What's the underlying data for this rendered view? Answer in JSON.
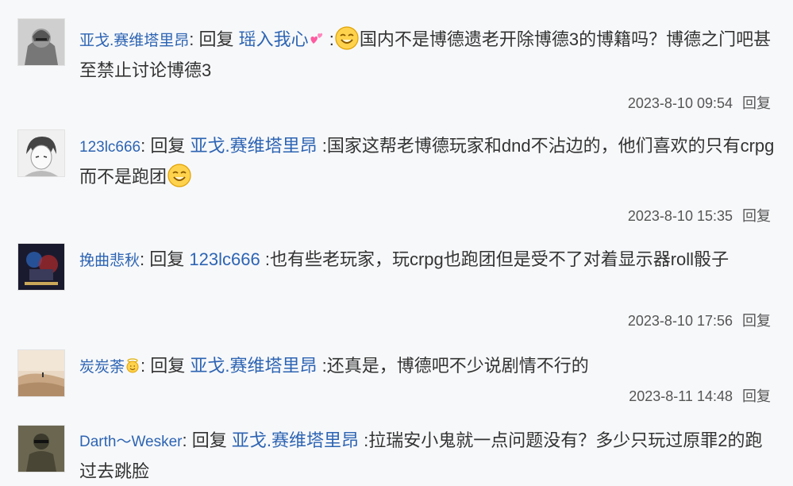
{
  "replies": [
    {
      "username": "亚戈.赛维塔里昂",
      "reply_word": "回复",
      "target": "瑶入我心",
      "target_icon": "pink-hearts-icon",
      "content_prefix_icon": "smile-emoji-icon",
      "content": "国内不是博德遗老开除博德3的博籍吗？博德之门吧甚至禁止讨论博德3",
      "time": "2023-8-10 09:54",
      "reply_action": "回复"
    },
    {
      "username": "123lc666",
      "reply_word": "回复",
      "target": "亚戈.赛维塔里昂",
      "content": "国家这帮老博德玩家和dnd不沾边的，他们喜欢的只有crpg而不是跑团",
      "content_suffix_icon": "smile-emoji-icon",
      "time": "2023-8-10 15:35",
      "reply_action": "回复"
    },
    {
      "username": "挽曲悲秋",
      "reply_word": "回复",
      "target": "123lc666",
      "content": "也有些老玩家，玩crpg也跑团但是受不了对着显示器roll骰子",
      "time": "2023-8-10 17:56",
      "reply_action": "回复"
    },
    {
      "username": "炭炭荼",
      "username_icon": "angel-emoji-icon",
      "reply_word": "回复",
      "target": "亚戈.赛维塔里昂",
      "content": "还真是，博德吧不少说剧情不行的",
      "time": "2023-8-11 14:48",
      "reply_action": "回复"
    },
    {
      "username": "Darth～Wesker",
      "reply_word": "回复",
      "target": "亚戈.赛维塔里昂",
      "content": "拉瑞安小鬼就一点问题没有？多少只玩过原罪2的跑过去跳脸"
    }
  ],
  "colors": {
    "link": "#2d64b3",
    "text": "#333333",
    "background": "#f7f8fa"
  }
}
